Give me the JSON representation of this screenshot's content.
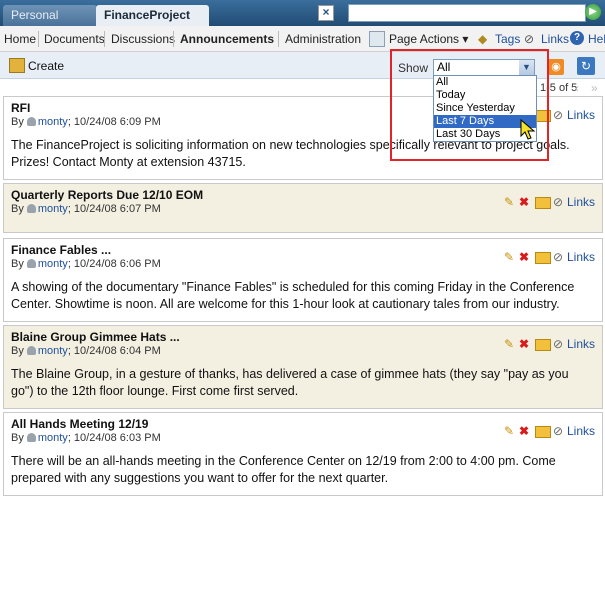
{
  "tabs": [
    {
      "label": "Personal Space"
    },
    {
      "label": "FinanceProject"
    }
  ],
  "nav": {
    "items": [
      "Home",
      "Documents",
      "Discussions",
      "Announcements",
      "Administration"
    ],
    "page_actions": "Page Actions ▾",
    "tags": "Tags",
    "links": "Links",
    "help": "Hel"
  },
  "toolbar": {
    "create": "Create",
    "show_label": "Show",
    "show_value": "All",
    "pagination": "1-5 of 5"
  },
  "dropdown": {
    "options": [
      "All",
      "Today",
      "Since Yesterday",
      "Last 7 Days",
      "Last 30 Days"
    ],
    "selected": "Last 7 Days"
  },
  "announcements": [
    {
      "title": "RFI",
      "by": "By",
      "user": "monty",
      "date": "; 10/24/08 6:09 PM",
      "body": "The FinanceProject is soliciting information on new technologies specifically relevant to project goals. Prizes! Contact Monty at extension 43715."
    },
    {
      "title": "Quarterly Reports Due 12/10 EOM",
      "by": "By",
      "user": "monty",
      "date": "; 10/24/08 6:07 PM",
      "body": ""
    },
    {
      "title": "Finance Fables ...",
      "by": "By",
      "user": "monty",
      "date": "; 10/24/08 6:06 PM",
      "body": "A showing of the documentary \"Finance Fables\" is scheduled for this coming Friday in the Conference Center. Showtime is noon. All are welcome for this 1-hour look at cautionary tales from our industry."
    },
    {
      "title": "Blaine Group Gimmee Hats ...",
      "by": "By",
      "user": "monty",
      "date": "; 10/24/08 6:04 PM",
      "body": "The Blaine Group, in a gesture of thanks, has delivered a case of gimmee hats (they say \"pay as you go\") to the 12th floor lounge. First come first served."
    },
    {
      "title": "All Hands Meeting 12/19",
      "by": "By",
      "user": "monty",
      "date": "; 10/24/08 6:03 PM",
      "body": "There will be an all-hands meeting in the Conference Center on 12/19 from 2:00 to 4:00 pm. Come prepared with any suggestions you want to offer for the next quarter."
    }
  ],
  "links_label": "Links",
  "icons": {
    "close": "×",
    "go": "▶",
    "rss": "rss-icon",
    "refresh": "refresh-icon"
  },
  "colors": {
    "accent": "#2a5c8a",
    "alt_row": "#f3f0e2",
    "highlight": "#e0242a",
    "selected": "#316ac5"
  }
}
